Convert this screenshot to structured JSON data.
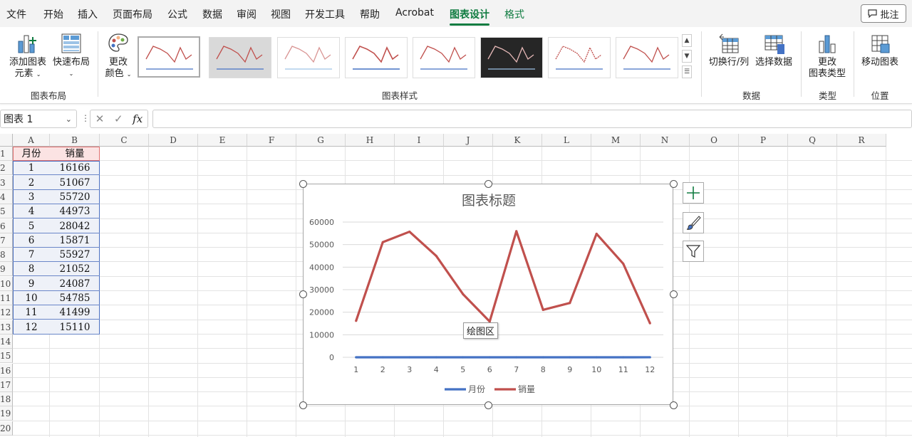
{
  "menu": [
    "文件",
    "开始",
    "插入",
    "页面布局",
    "公式",
    "数据",
    "审阅",
    "视图",
    "开发工具",
    "帮助",
    "Acrobat",
    "图表设计",
    "格式"
  ],
  "comment_label": "批注",
  "ribbon": {
    "add_element_1": "添加图表",
    "add_element_2": "元素",
    "quick_layout": "快速布局",
    "change_color_1": "更改",
    "change_color_2": "颜色",
    "switch_row_col": "切换行/列",
    "select_data": "选择数据",
    "change_type_1": "更改",
    "change_type_2": "图表类型",
    "move_chart": "移动图表",
    "groups": {
      "layout": "图表布局",
      "styles": "图表样式",
      "data": "数据",
      "type": "类型",
      "location": "位置"
    }
  },
  "namebox": "图表 1",
  "columns": [
    "A",
    "B",
    "C",
    "D",
    "E",
    "F",
    "G",
    "H",
    "I",
    "J",
    "K",
    "L",
    "M",
    "N",
    "O",
    "P",
    "Q",
    "R"
  ],
  "rows": [
    "1",
    "2",
    "3",
    "4",
    "5",
    "6",
    "7",
    "8",
    "9",
    "10",
    "11",
    "12",
    "13",
    "14",
    "15",
    "16",
    "17",
    "18",
    "19",
    "20"
  ],
  "table": {
    "headers": [
      "月份",
      "销量"
    ],
    "rows": [
      [
        "1",
        "16166"
      ],
      [
        "2",
        "51067"
      ],
      [
        "3",
        "55720"
      ],
      [
        "4",
        "44973"
      ],
      [
        "5",
        "28042"
      ],
      [
        "6",
        "15871"
      ],
      [
        "7",
        "55927"
      ],
      [
        "8",
        "21052"
      ],
      [
        "9",
        "24087"
      ],
      [
        "10",
        "54785"
      ],
      [
        "11",
        "41499"
      ],
      [
        "12",
        "15110"
      ]
    ]
  },
  "tooltip": "绘图区",
  "colors": {
    "accent": "#107c41",
    "series_month": "#4472c4",
    "series_sales": "#c0504d"
  },
  "chart_data": {
    "type": "line",
    "title": "图表标题",
    "categories": [
      "1",
      "2",
      "3",
      "4",
      "5",
      "6",
      "7",
      "8",
      "9",
      "10",
      "11",
      "12"
    ],
    "series": [
      {
        "name": "月份",
        "values": [
          1,
          2,
          3,
          4,
          5,
          6,
          7,
          8,
          9,
          10,
          11,
          12
        ]
      },
      {
        "name": "销量",
        "values": [
          16166,
          51067,
          55720,
          44973,
          28042,
          15871,
          55927,
          21052,
          24087,
          54785,
          41499,
          15110
        ]
      }
    ],
    "yticks": [
      "0",
      "10000",
      "20000",
      "30000",
      "40000",
      "50000",
      "60000"
    ],
    "ylim": [
      0,
      60000
    ],
    "grid": true,
    "legend": "bottom"
  }
}
